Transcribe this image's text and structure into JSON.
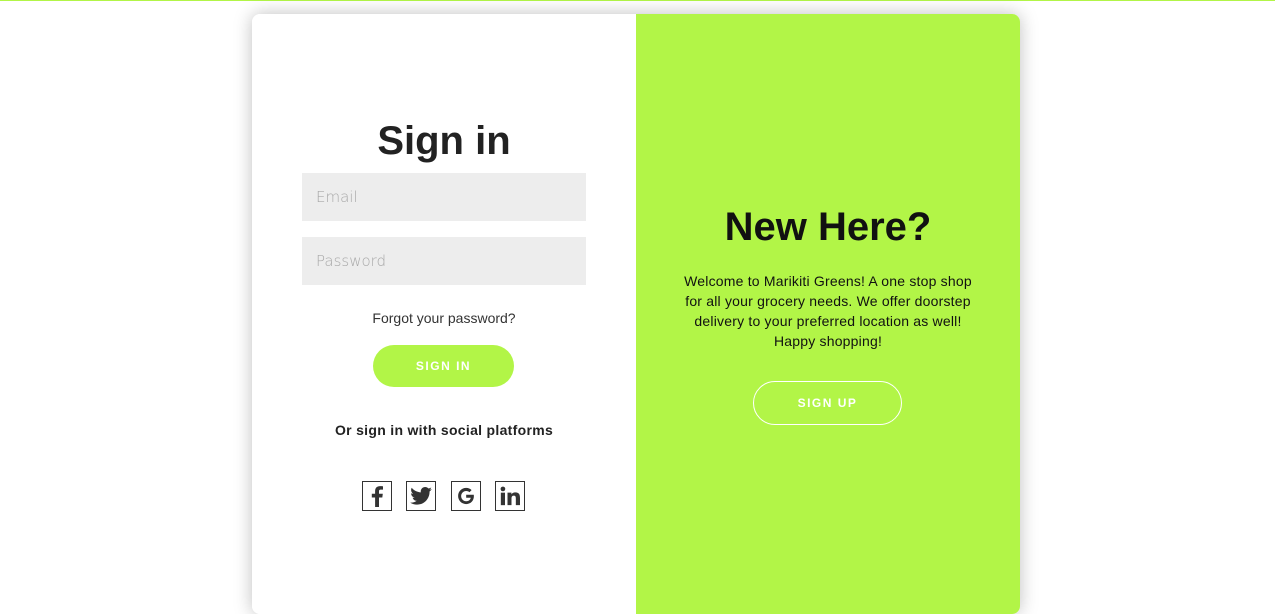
{
  "colors": {
    "accent": "#b2f547",
    "input_bg": "#ededed",
    "text_dark": "#222222",
    "button_text": "#ffffff"
  },
  "signin": {
    "title": "Sign in",
    "email_placeholder": "Email",
    "email_value": "",
    "password_placeholder": "Password",
    "password_value": "",
    "forgot_link": "Forgot your password?",
    "button_label": "SIGN IN",
    "social_text": "Or sign in with social platforms",
    "social_icons": [
      "facebook-icon",
      "twitter-icon",
      "google-icon",
      "linkedin-icon"
    ]
  },
  "signup_panel": {
    "title": "New Here?",
    "description": "Welcome to Marikiti Greens! A one stop shop for all your grocery needs. We offer doorstep delivery to your preferred location as well! Happy shopping!",
    "button_label": "SIGN UP"
  }
}
